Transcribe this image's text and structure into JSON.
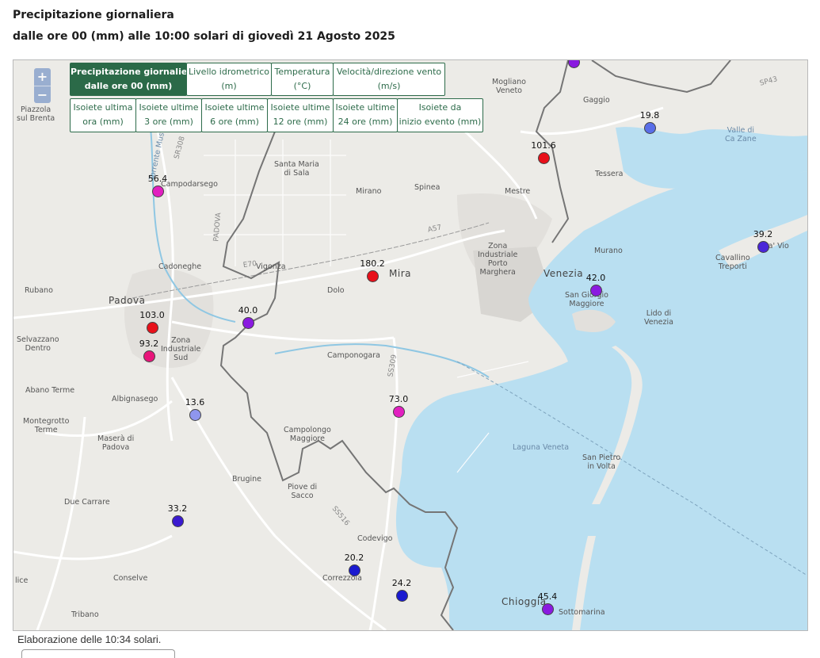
{
  "header": {
    "title": "Precipitazione giornaliera",
    "subtitle": "dalle ore 00 (mm) alle 10:00 solari di giovedì 21 Agosto 2025"
  },
  "zoom": {
    "in_label": "+",
    "out_label": "−"
  },
  "tabs_row1": [
    {
      "line1": "Precipitazione giornaliera",
      "line2": "dalle ore 00 (mm)",
      "active": true
    },
    {
      "line1": "Livello idrometrico",
      "line2": "(m)",
      "active": false
    },
    {
      "line1": "Temperatura",
      "line2": "(°C)",
      "active": false
    },
    {
      "line1": "Velocità/direzione vento",
      "line2": "(m/s)",
      "active": false
    }
  ],
  "tabs_row2": [
    {
      "line1": "Isoiete ultima",
      "line2": "ora (mm)"
    },
    {
      "line1": "Isoiete ultime",
      "line2": "3 ore (mm)"
    },
    {
      "line1": "Isoiete ultime",
      "line2": "6 ore (mm)"
    },
    {
      "line1": "Isoiete ultime",
      "line2": "12 ore (mm)"
    },
    {
      "line1": "Isoiete ultime",
      "line2": "24 ore (mm)"
    },
    {
      "line1": "Isoiete da",
      "line2": "inizio evento (mm)"
    }
  ],
  "stations": [
    {
      "value": "101.6",
      "color": "#e8101a"
    },
    {
      "value": "19.8",
      "color": "#5a6ee8"
    },
    {
      "value": "56.4",
      "color": "#e21fc0"
    },
    {
      "value": "180.2",
      "color": "#e8101a"
    },
    {
      "value": "39.2",
      "color": "#4a26d8"
    },
    {
      "value": "42.0",
      "color": "#8a1ae0"
    },
    {
      "value": "103.0",
      "color": "#e8101a"
    },
    {
      "value": "40.0",
      "color": "#8a1ae0"
    },
    {
      "value": "93.2",
      "color": "#e8157a"
    },
    {
      "value": "73.0",
      "color": "#e21fc0"
    },
    {
      "value": "13.6",
      "color": "#8f96ee"
    },
    {
      "value": "33.2",
      "color": "#3a1ad0"
    },
    {
      "value": "20.2",
      "color": "#1a1ad0"
    },
    {
      "value": "24.2",
      "color": "#1a1ad0"
    },
    {
      "value": "45.4",
      "color": "#8a1ae0"
    }
  ],
  "place_labels": {
    "piazzola": "Piazzola\nsul Brenta",
    "mogliano": "Mogliano\nVeneto",
    "gaggio": "Gaggio",
    "valle_cazane": "Valle di\nCa Zane",
    "tessera": "Tessera",
    "campodarsego": "Campodarsego",
    "santa_maria": "Santa Maria\ndi Sala",
    "mirano": "Mirano",
    "spinea": "Spinea",
    "mestre": "Mestre",
    "porto_marghera": "Zona\nIndustriale\nPorto\nMarghera",
    "cadoneghe": "Cadoneghe",
    "vigonza": "Vigonza",
    "mira": "Mira",
    "dolo": "Dolo",
    "murano": "Murano",
    "venezia": "Venezia",
    "san_giorgio": "San Giorgio\nMaggiore",
    "lido": "Lido di\nVenezia",
    "cavallino": "Cavallino\nTreporti",
    "cavallino_extra": "Ca' Vio",
    "rubano": "Rubano",
    "padova": "Padova",
    "selvazzano": "Selvazzano\nDentro",
    "zona_ind_sud": "Zona\nIndustriale\nSud",
    "camponogara": "Camponogara",
    "abano": "Abano Terme",
    "albignasego": "Albignasego",
    "montegrotto": "Montegrotto\nTerme",
    "masera": "Maserà di\nPadova",
    "campolongo": "Campolongo\nMaggiore",
    "laguna": "Laguna Veneta",
    "pellestrina": "San Pietro\nin Volta",
    "brugine": "Brugine",
    "piove": "Piove di\nSacco",
    "due_carrare": "Due Carrare",
    "codevigo": "Codevigo",
    "correzzola": "Correzzola",
    "conselve": "Conselve",
    "chioggia": "Chioggia",
    "sottomarina": "Sottomarina",
    "tribano": "Tribano",
    "ice": "lice",
    "road_a57": "A57",
    "road_e70": "E70",
    "road_ss309": "SS309",
    "road_ss516": "SS516",
    "road_sp43": "SP43",
    "road_sr308": "SR308",
    "river_muson": "Torrente Muson",
    "padova_border": "PADOVA"
  },
  "footer": {
    "text": "Elaborazione delle 10:34 solari."
  }
}
